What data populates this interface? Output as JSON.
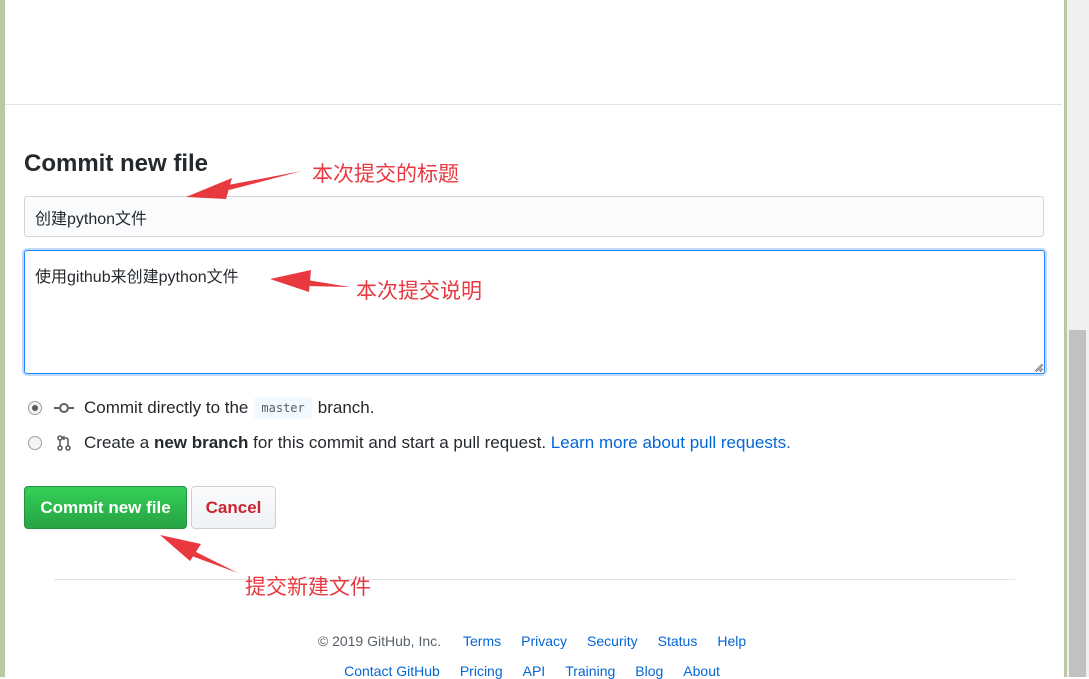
{
  "form": {
    "heading": "Commit new file",
    "summary_value": "创建python文件",
    "description_value": "使用github来创建python文件",
    "option_direct": {
      "text_before": "Commit directly to the",
      "branch": "master",
      "text_after": "branch."
    },
    "option_new_branch": {
      "text_before": "Create a",
      "strong": "new branch",
      "text_after": "for this commit and start a pull request.",
      "link": "Learn more about pull requests."
    },
    "commit_button": "Commit new file",
    "cancel_button": "Cancel"
  },
  "footer": {
    "copyright": "© 2019 GitHub, Inc.",
    "row1_links": [
      "Terms",
      "Privacy",
      "Security",
      "Status",
      "Help"
    ],
    "row2_links": [
      "Contact GitHub",
      "Pricing",
      "API",
      "Training",
      "Blog",
      "About"
    ]
  },
  "annotations": {
    "title_note": "本次提交的标题",
    "desc_note": "本次提交说明",
    "submit_note": "提交新建文件"
  },
  "colors": {
    "primary_button": "#28a745",
    "cancel_text": "#cb2431",
    "link": "#0366d6",
    "annotation": "#e8393f"
  }
}
